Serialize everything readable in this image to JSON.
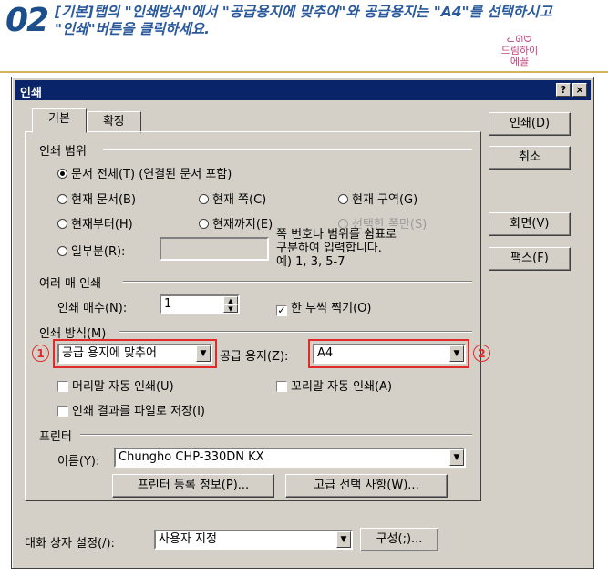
{
  "header": {
    "step_number": "02",
    "instruction": "[기본]탭의 \"인쇄방식\"에서 \"공급용지에 맞추어\"와 공급용지는 \"A4\"를 선택하시고\n\"인쇄\"버튼을 클릭하세요.",
    "logo_line1": "드림하이",
    "logo_line2": "에꼴",
    "logo_ornament": "ᓚᘏᗢ"
  },
  "dialog": {
    "title": "인쇄",
    "help_btn": "?",
    "close_btn": "×",
    "tabs": {
      "basic": "기본",
      "expand": "확장"
    },
    "print_range": {
      "label": "인쇄 범위",
      "all": "문서 전체(T) (연결된 문서 포함)",
      "current_doc": "현재 문서(B)",
      "current_page": "현재 쪽(C)",
      "current_section": "현재 구역(G)",
      "from_current": "현재부터(H)",
      "to_current": "현재까지(E)",
      "selected_page": "선택한 쪽만(S)",
      "partial": "일부분(R):",
      "partial_value": "",
      "hint": "쪽 번호나 범위를 쉼표로\n구분하여 입력합니다.\n예) 1, 3, 5-7"
    },
    "multi_print": {
      "label": "여러 매 인쇄",
      "copies_label": "인쇄 매수(N):",
      "copies_value": "1",
      "collate_label": "한 부씩 찍기(O)",
      "collate_checked": true
    },
    "print_method": {
      "label": "인쇄 방식(M)",
      "method_value": "공급 용지에 맞추어",
      "paper_label": "공급 용지(Z):",
      "paper_value": "A4",
      "header_auto": "머리말 자동 인쇄(U)",
      "footer_auto": "꼬리말 자동 인쇄(A)",
      "to_file": "인쇄 결과를 파일로 저장(I)"
    },
    "printer": {
      "label": "프린터",
      "name_label": "이름(Y):",
      "name_value": "Chungho CHP-330DN KX",
      "register_btn": "프린터 등록 정보(P)...",
      "advanced_btn": "고급 선택 사항(W)..."
    },
    "buttons": {
      "print": "인쇄(D)",
      "cancel": "취소",
      "screen": "화면(V)",
      "fax": "팩스(F)"
    },
    "bottom": {
      "settings_label": "대화 상자 설정(/):",
      "settings_value": "사용자 지정",
      "config_btn": "구성(;)..."
    }
  },
  "annotations": {
    "one": "1",
    "two": "2",
    "color": "#e12b2b"
  },
  "colors": {
    "titlebar": "#0a246a",
    "dialog_bg": "#d4d0c8",
    "instruction_blue": "#2a5a9c",
    "logo_pink": "#c4417e"
  }
}
